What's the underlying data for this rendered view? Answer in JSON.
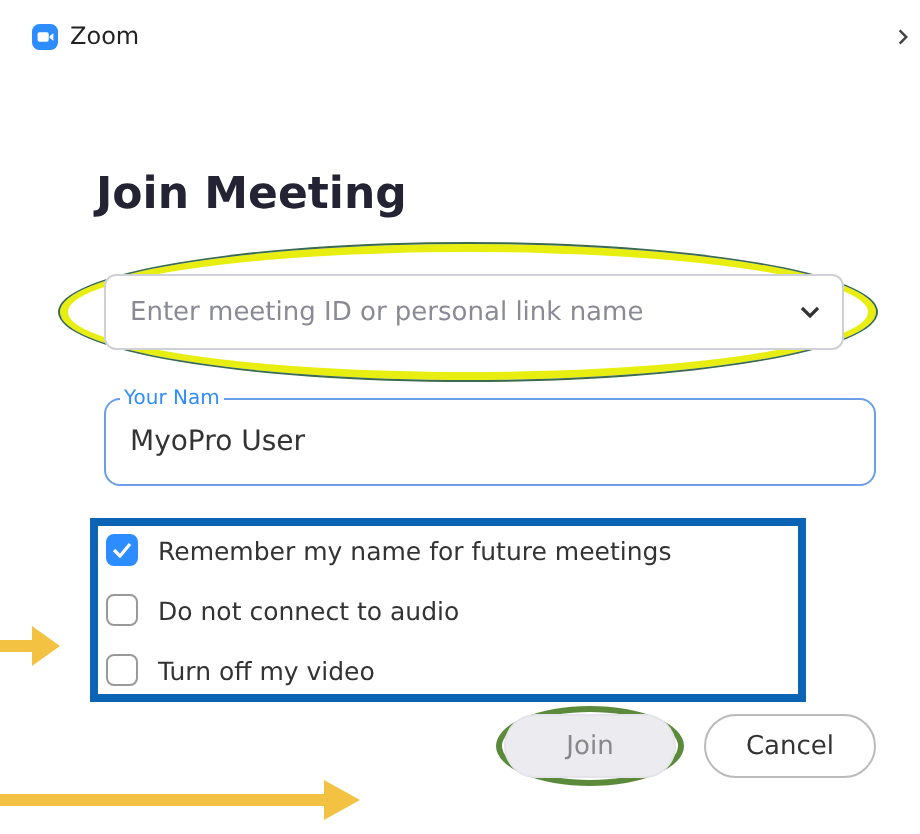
{
  "window": {
    "title": "Zoom"
  },
  "heading": "Join Meeting",
  "meeting_field": {
    "placeholder": "Enter meeting ID or personal link name"
  },
  "name_field": {
    "label": "Your Nam",
    "value": "MyoPro User"
  },
  "options": [
    {
      "label": "Remember my name for future meetings",
      "checked": true
    },
    {
      "label": "Do not connect to audio",
      "checked": false
    },
    {
      "label": "Turn off my video",
      "checked": false
    }
  ],
  "buttons": [
    {
      "label": "Join",
      "disabled": true
    },
    {
      "label": "Cancel",
      "disabled": false
    }
  ]
}
